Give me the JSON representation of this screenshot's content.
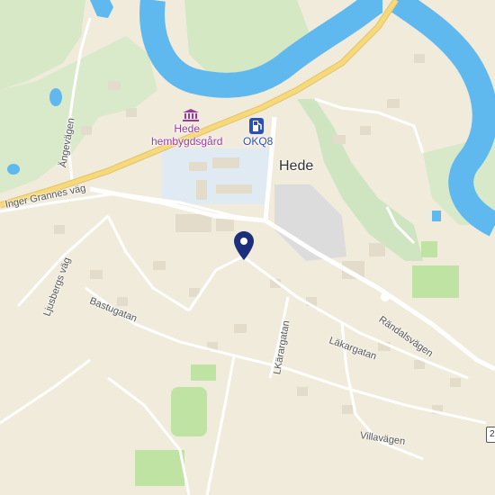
{
  "map": {
    "place_label": "Hede",
    "poi_museum": {
      "line1": "Hede",
      "line2": "hembygdsgård",
      "icon": "museum-icon"
    },
    "poi_fuel": {
      "label": "OKQ8",
      "icon": "fuel-station-icon"
    },
    "marker_icon": "location-pin-icon",
    "route_shield": "2",
    "streets": {
      "inger_grannes_vag": "Inger Grannes väg",
      "angevagen": "Ängevägen",
      "ljusbergs_vag": "Ljusbergs väg",
      "bastugatan": "Bastugatan",
      "lkarargatan": "LKärargatan",
      "lakargatan": "Läkargatan",
      "randalsvagen": "Rändalsvägen",
      "villavagen": "Villavägen"
    },
    "colors": {
      "water": "#5fb9ee",
      "park": "#cfe5c1",
      "major_road": "#f6d97a",
      "minor_road": "#ffffff",
      "pin": "#1d2e7a",
      "background": "#f1ebdc"
    }
  }
}
